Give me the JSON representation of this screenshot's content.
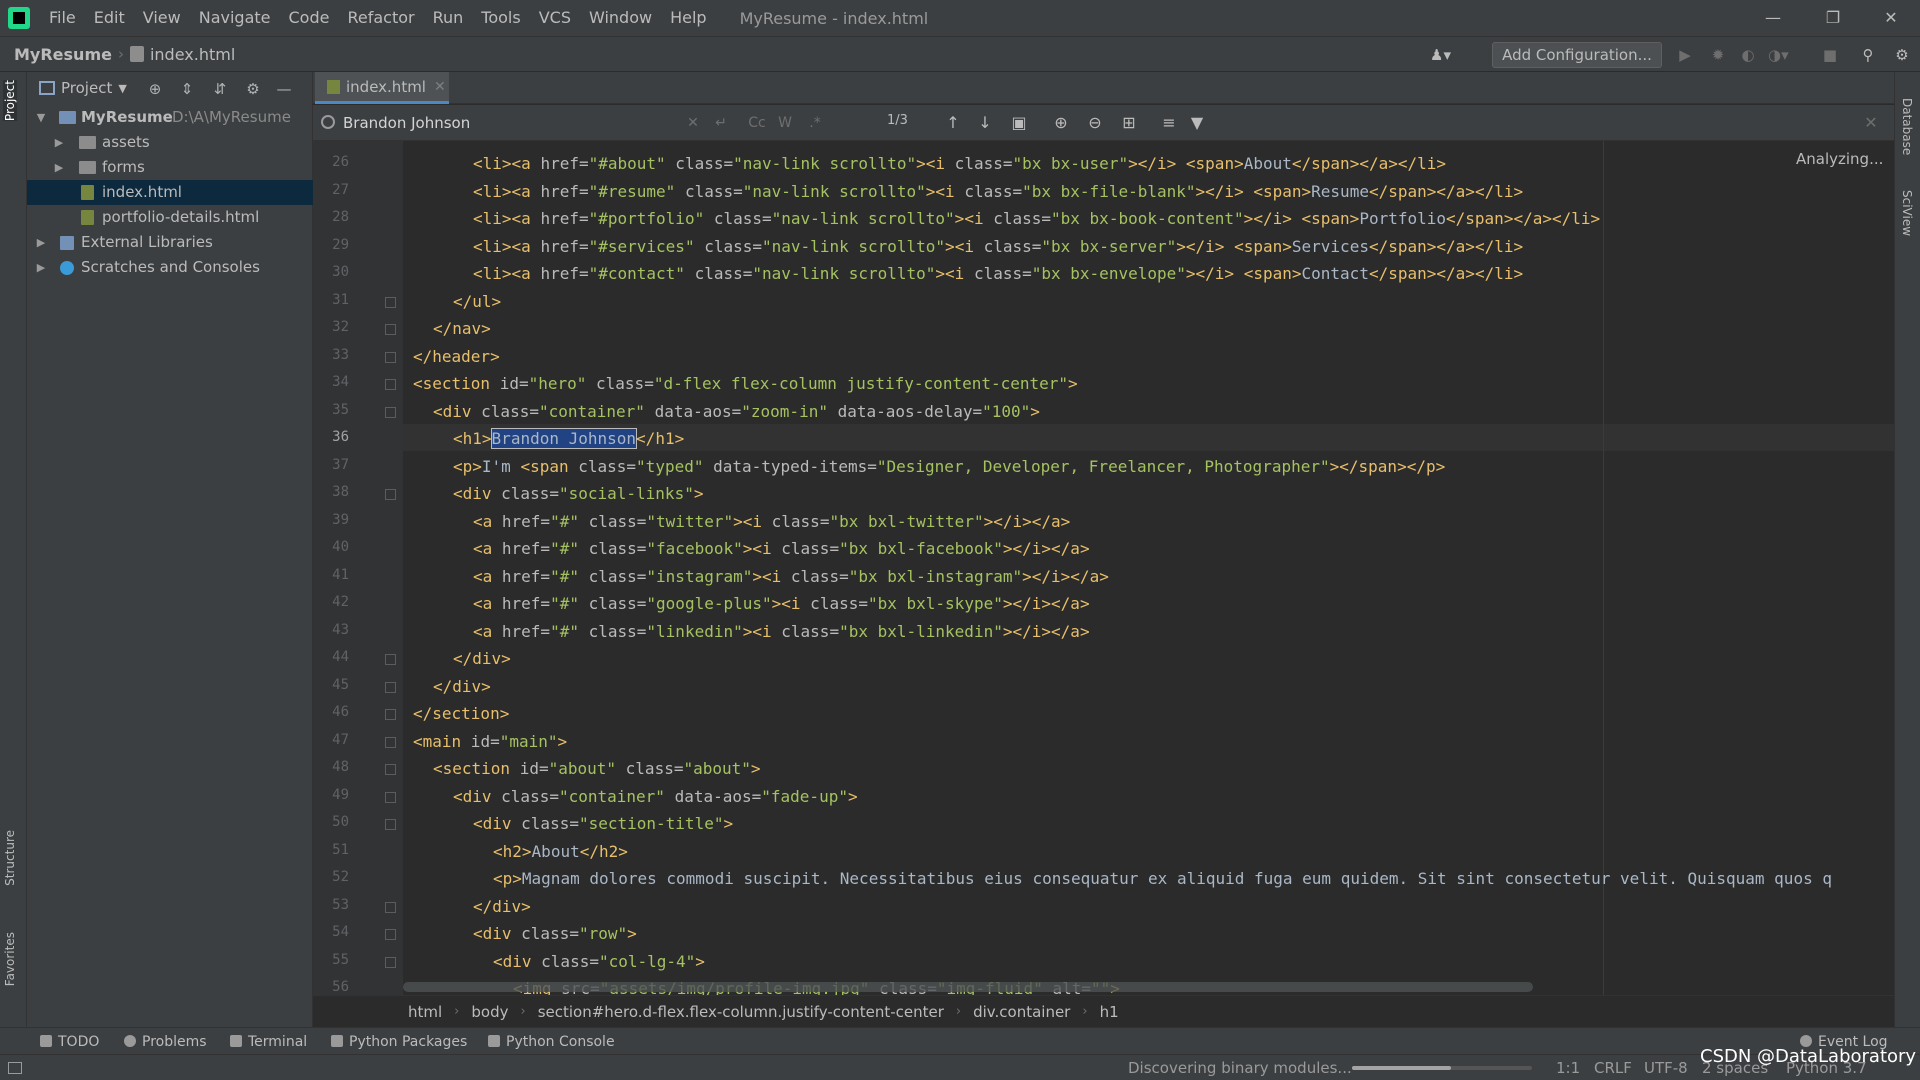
{
  "menu": [
    "File",
    "Edit",
    "View",
    "Navigate",
    "Code",
    "Refactor",
    "Run",
    "Tools",
    "VCS",
    "Window",
    "Help"
  ],
  "window_title": "MyResume - index.html",
  "nav": {
    "project": "MyResume",
    "file": "index.html",
    "add_config": "Add Configuration..."
  },
  "left_stripe": {
    "project": "Project",
    "structure": "Structure",
    "favorites": "Favorites"
  },
  "right_stripe": {
    "database": "Database",
    "sciview": "SciView"
  },
  "project_panel": {
    "title": "Project",
    "tree": [
      {
        "label": "MyResume",
        "path": "D:\\A\\MyResume",
        "bold": true
      },
      {
        "label": "assets"
      },
      {
        "label": "forms"
      },
      {
        "label": "index.html"
      },
      {
        "label": "portfolio-details.html"
      },
      {
        "label": "External Libraries"
      },
      {
        "label": "Scratches and Consoles"
      }
    ]
  },
  "tab": {
    "label": "index.html"
  },
  "search": {
    "query": "Brandon Johnson",
    "match_count": "1/3",
    "opt_case": "Cc",
    "opt_word": "W",
    "opt_regex": ".*"
  },
  "editor": {
    "status": "Analyzing...",
    "lines": [
      {
        "n": "26",
        "code": "<li><a href=\"#about\" class=\"nav-link scrollto\"><i class=\"bx bx-user\"></i> <span>About</span></a></li>"
      },
      {
        "n": "27",
        "code": "<li><a href=\"#resume\" class=\"nav-link scrollto\"><i class=\"bx bx-file-blank\"></i> <span>Resume</span></a></li>"
      },
      {
        "n": "28",
        "code": "<li><a href=\"#portfolio\" class=\"nav-link scrollto\"><i class=\"bx bx-book-content\"></i> <span>Portfolio</span></a></li>"
      },
      {
        "n": "29",
        "code": "<li><a href=\"#services\" class=\"nav-link scrollto\"><i class=\"bx bx-server\"></i> <span>Services</span></a></li>"
      },
      {
        "n": "30",
        "code": "<li><a href=\"#contact\" class=\"nav-link scrollto\"><i class=\"bx bx-envelope\"></i> <span>Contact</span></a></li>"
      },
      {
        "n": "31",
        "code": "</ul>"
      },
      {
        "n": "32",
        "code": "</nav>"
      },
      {
        "n": "33",
        "code": "</header>"
      },
      {
        "n": "34",
        "code": "<section id=\"hero\" class=\"d-flex flex-column justify-content-center\">"
      },
      {
        "n": "35",
        "code": "<div class=\"container\" data-aos=\"zoom-in\" data-aos-delay=\"100\">"
      },
      {
        "n": "36",
        "code": "<h1>Brandon Johnson</h1>"
      },
      {
        "n": "37",
        "code": "<p>I'm <span class=\"typed\" data-typed-items=\"Designer, Developer, Freelancer, Photographer\"></span></p>"
      },
      {
        "n": "38",
        "code": "<div class=\"social-links\">"
      },
      {
        "n": "39",
        "code": "<a href=\"#\" class=\"twitter\"><i class=\"bx bxl-twitter\"></i></a>"
      },
      {
        "n": "40",
        "code": "<a href=\"#\" class=\"facebook\"><i class=\"bx bxl-facebook\"></i></a>"
      },
      {
        "n": "41",
        "code": "<a href=\"#\" class=\"instagram\"><i class=\"bx bxl-instagram\"></i></a>"
      },
      {
        "n": "42",
        "code": "<a href=\"#\" class=\"google-plus\"><i class=\"bx bxl-skype\"></i></a>"
      },
      {
        "n": "43",
        "code": "<a href=\"#\" class=\"linkedin\"><i class=\"bx bxl-linkedin\"></i></a>"
      },
      {
        "n": "44",
        "code": "</div>"
      },
      {
        "n": "45",
        "code": "</div>"
      },
      {
        "n": "46",
        "code": "</section>"
      },
      {
        "n": "47",
        "code": "<main id=\"main\">"
      },
      {
        "n": "48",
        "code": "<section id=\"about\" class=\"about\">"
      },
      {
        "n": "49",
        "code": "<div class=\"container\" data-aos=\"fade-up\">"
      },
      {
        "n": "50",
        "code": "<div class=\"section-title\">"
      },
      {
        "n": "51",
        "code": "<h2>About</h2>"
      },
      {
        "n": "52",
        "code": "<p>Magnam dolores commodi suscipit. Necessitatibus eius consequatur ex aliquid fuga eum quidem. Sit sint consectetur velit. Quisquam quos q"
      },
      {
        "n": "53",
        "code": "</div>"
      },
      {
        "n": "54",
        "code": "<div class=\"row\">"
      },
      {
        "n": "55",
        "code": "<div class=\"col-lg-4\">"
      },
      {
        "n": "56",
        "code": "<img src=\"assets/img/profile-img.jpg\" class=\"img-fluid\" alt=\"\">"
      }
    ]
  },
  "breadcrumbs": [
    "html",
    "body",
    "section#hero.d-flex.flex-column.justify-content-center",
    "div.container",
    "h1"
  ],
  "tool_windows": [
    "TODO",
    "Problems",
    "Terminal",
    "Python Packages",
    "Python Console"
  ],
  "event_log": "Event Log",
  "status": {
    "task": "Discovering binary modules...",
    "position": "1:1",
    "line_sep": "CRLF",
    "encoding": "UTF-8",
    "indent": "2 spaces",
    "interpreter": "Python 3.7",
    "progress_fraction": 0.55
  },
  "watermark": "CSDN @DataLaboratory"
}
